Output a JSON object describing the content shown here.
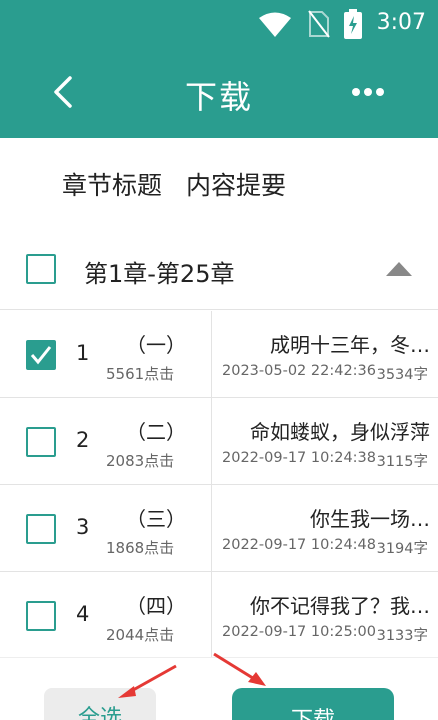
{
  "status_bar": {
    "time": "3:07"
  },
  "app_bar": {
    "title": "下载"
  },
  "tabs": [
    {
      "label": "章节标题"
    },
    {
      "label": "内容提要"
    }
  ],
  "group": {
    "title": "第1章-第25章",
    "checked": false
  },
  "chapters": [
    {
      "num": "1",
      "title": "（一）",
      "clicks": "5561点击",
      "summary": "成明十三年，冬…",
      "date": "2023-05-02 22:42:36",
      "words": "3534字",
      "checked": true
    },
    {
      "num": "2",
      "title": "（二）",
      "clicks": "2083点击",
      "summary": "命如蝼蚁，身似浮萍",
      "date": "2022-09-17 10:24:38",
      "words": "3115字",
      "checked": false
    },
    {
      "num": "3",
      "title": "（三）",
      "clicks": "1868点击",
      "summary": "你生我一场…",
      "date": "2022-09-17 10:24:48",
      "words": "3194字",
      "checked": false
    },
    {
      "num": "4",
      "title": "（四）",
      "clicks": "2044点击",
      "summary": "你不记得我了？我…",
      "date": "2022-09-17 10:25:00",
      "words": "3133字",
      "checked": false
    }
  ],
  "buttons": {
    "select_all": "全选",
    "download": "下载"
  },
  "colors": {
    "primary": "#2a9d8f",
    "annotation_arrow": "#e53935"
  }
}
